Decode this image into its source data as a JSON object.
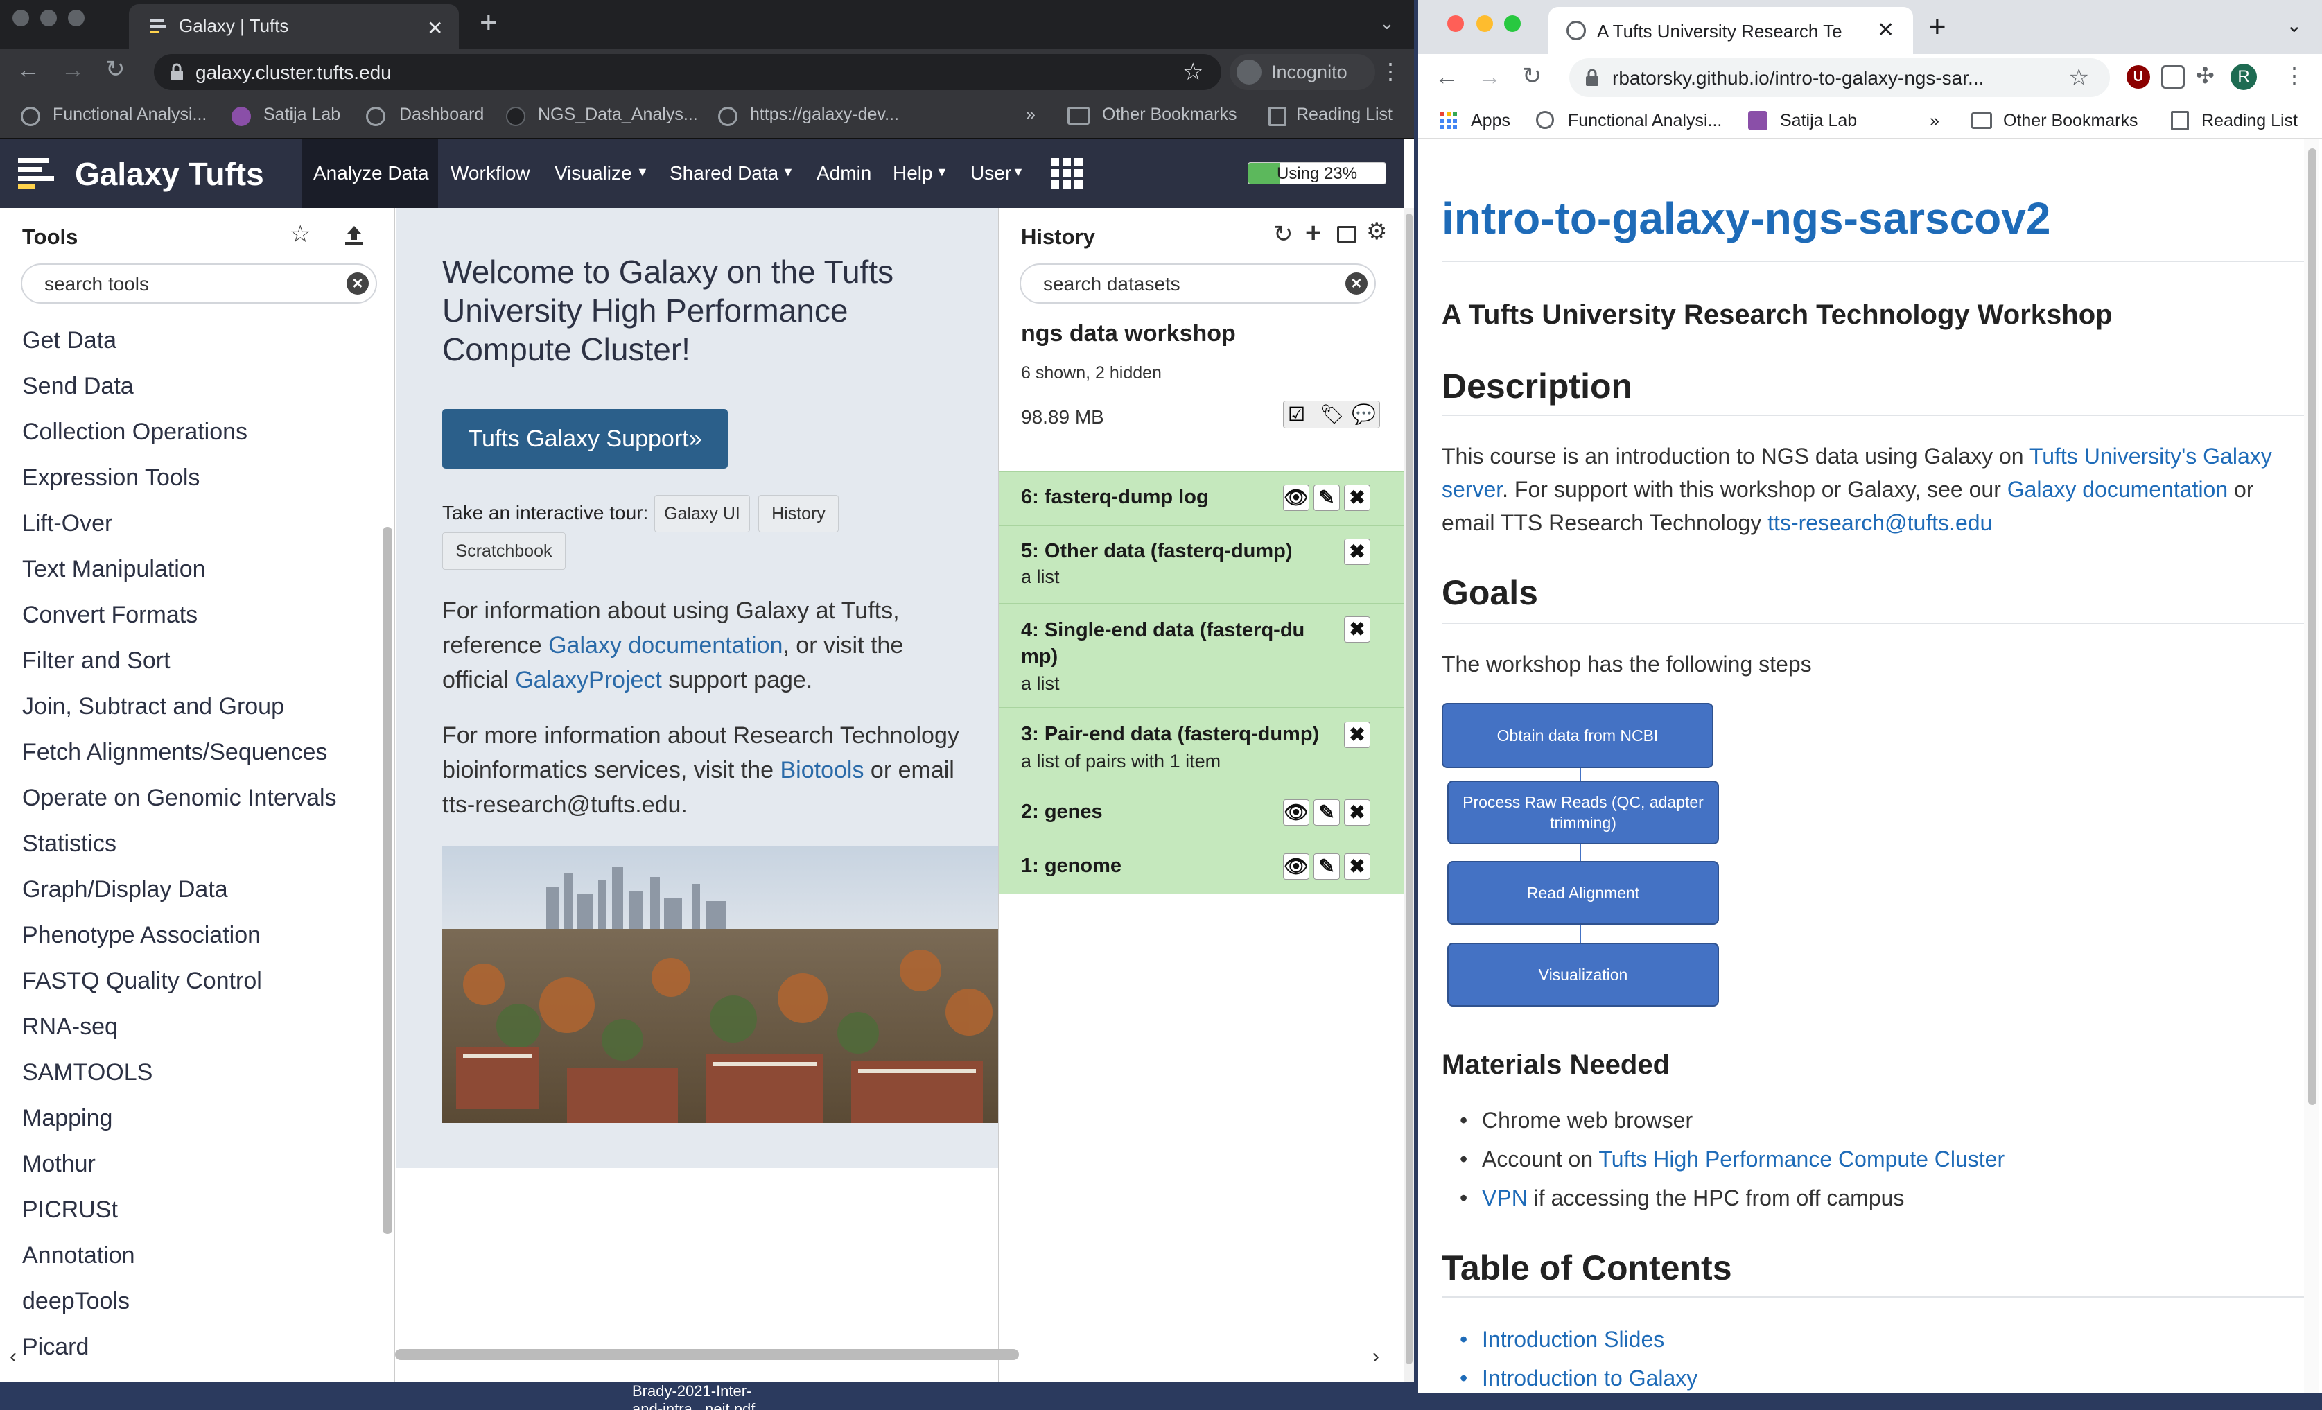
{
  "left_browser": {
    "tab_title": "Galaxy | Tufts",
    "url": "galaxy.cluster.tufts.edu",
    "profile_label": "Incognito",
    "bookmarks": [
      "Functional Analysi...",
      "Satija Lab",
      "Dashboard",
      "NGS_Data_Analys...",
      "https://galaxy-dev..."
    ],
    "bookmarks_more": "»",
    "other_bookmarks": "Other Bookmarks",
    "reading_list": "Reading List"
  },
  "galaxy": {
    "brand": "Galaxy Tufts",
    "nav": [
      "Analyze Data",
      "Workflow",
      "Visualize",
      "Shared Data",
      "Admin",
      "Help",
      "User"
    ],
    "quota_label": "Using 23%",
    "quota_percent": 23,
    "tools_title": "Tools",
    "tool_search_placeholder": "search tools",
    "tools": [
      "Get Data",
      "Send Data",
      "Collection Operations",
      "Expression Tools",
      "Lift-Over",
      "Text Manipulation",
      "Convert Formats",
      "Filter and Sort",
      "Join, Subtract and Group",
      "Fetch Alignments/Sequences",
      "Operate on Genomic Intervals",
      "Statistics",
      "Graph/Display Data",
      "Phenotype Association",
      "FASTQ Quality Control",
      "RNA-seq",
      "SAMTOOLS",
      "Mapping",
      "Mothur",
      "PICRUSt",
      "Annotation",
      "deepTools",
      "Picard"
    ],
    "welcome": {
      "heading": "Welcome to Galaxy on the Tufts University High Performance Compute Cluster!",
      "support_button": "Tufts Galaxy Support»",
      "tour_label": "Take an interactive tour:",
      "tour_buttons": [
        "Galaxy UI",
        "History",
        "Scratchbook"
      ],
      "p1_a": "For information about using Galaxy at Tufts, reference ",
      "p1_link1": "Galaxy documentation",
      "p1_b": ", or visit the official ",
      "p1_link2": "GalaxyProject",
      "p1_c": " support page.",
      "p2_a": "For more information about Research Technology bioinformatics services, visit the ",
      "p2_link": "Biotools",
      "p2_b": " or email tts-research@tufts.edu."
    },
    "history": {
      "title": "History",
      "search_placeholder": "search datasets",
      "name": "ngs data workshop",
      "shown_hidden": "6 shown, 2 hidden",
      "size": "98.89 MB",
      "datasets": [
        {
          "title": "6: fasterq-dump log",
          "sub": ""
        },
        {
          "title": "5: Other data (fasterq-dump)",
          "sub": "a list"
        },
        {
          "title": "4: Single-end data (fasterq-du",
          "title2": "mp)",
          "sub": "a list"
        },
        {
          "title": "3: Pair-end data (fasterq-dump)",
          "sub": "a list of pairs with 1 item"
        },
        {
          "title": "2: genes",
          "sub": ""
        },
        {
          "title": "1: genome",
          "sub": ""
        }
      ]
    }
  },
  "right_browser": {
    "tab_title": "A Tufts University Research Te",
    "url": "rbatorsky.github.io/intro-to-galaxy-ngs-sar...",
    "profile_initial": "R",
    "bookmarks": [
      "Apps",
      "Functional Analysi...",
      "Satija Lab"
    ],
    "bookmarks_more": "»",
    "other_bookmarks": "Other Bookmarks",
    "reading_list": "Reading List"
  },
  "doc": {
    "title": "intro-to-galaxy-ngs-sarscov2",
    "subtitle": "A Tufts University Research Technology Workshop",
    "h_description": "Description",
    "desc_a": "This course is an introduction to NGS data using Galaxy on ",
    "desc_link1": "Tufts University's Galaxy server",
    "desc_b": ". For support with this workshop or Galaxy, see our ",
    "desc_link2": "Galaxy documentation",
    "desc_c": " or email TTS Research Technology ",
    "desc_link3": "tts-research@tufts.edu",
    "h_goals": "Goals",
    "goals_intro": "The workshop has the following steps",
    "flow": [
      "Obtain data from NCBI",
      "Process Raw Reads (QC, adapter trimming)",
      "Read Alignment",
      "Visualization"
    ],
    "h_materials": "Materials Needed",
    "mat1": "Chrome web browser",
    "mat2_a": "Account on ",
    "mat2_link": "Tufts High Performance Compute Cluster",
    "mat3_link": "VPN",
    "mat3_b": " if accessing the HPC from off campus",
    "h_toc": "Table of Contents",
    "toc": [
      "Introduction Slides",
      "Introduction to Galaxy"
    ]
  },
  "desktop": {
    "file_label_1": "Brady-2021-Inter-",
    "file_label_2": "and-intra...neit.pdf"
  },
  "colors": {
    "galaxy_masthead": "#2c3143",
    "dataset_ok": "#c5e8bd",
    "link": "#1e6bb8",
    "flow_box": "#4472c4"
  }
}
